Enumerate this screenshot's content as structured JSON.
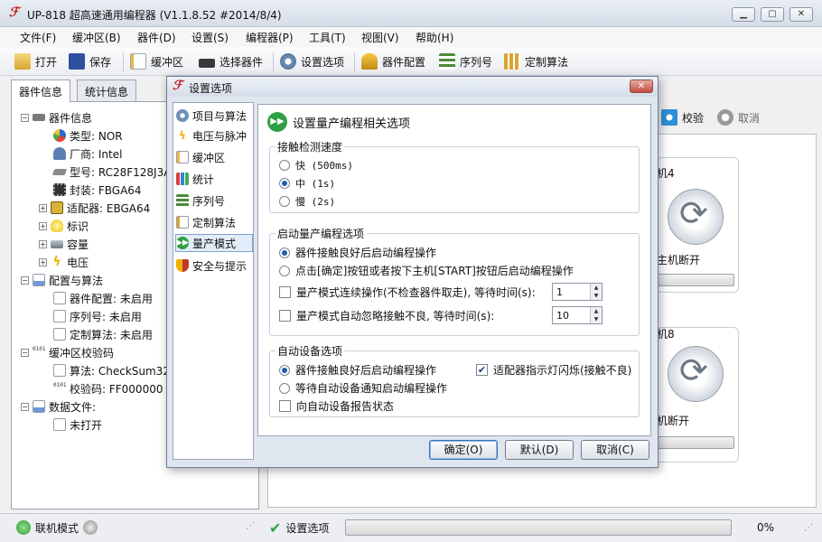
{
  "window": {
    "title": "UP-818 超高速通用编程器  (V1.1.8.52 #2014/8/4)"
  },
  "menu": [
    "文件(F)",
    "缓冲区(B)",
    "器件(D)",
    "设置(S)",
    "编程器(P)",
    "工具(T)",
    "视图(V)",
    "帮助(H)"
  ],
  "toolbar": {
    "open": "打开",
    "save": "保存",
    "buffer": "缓冲区",
    "select_device": "选择器件",
    "settings": "设置选项",
    "device_config": "器件配置",
    "serial": "序列号",
    "custom_algo": "定制算法"
  },
  "left_tabs": {
    "device_info": "器件信息",
    "stats": "统计信息"
  },
  "tree": {
    "device_info": "器件信息",
    "type": "类型: NOR",
    "vendor": "厂商: Intel",
    "model": "型号: RC28F128J3A",
    "package": "封装: FBGA64",
    "adapter": "适配器: EBGA64",
    "mark": "标识",
    "capacity": "容量",
    "voltage": "电压",
    "config_algo": "配置与算法",
    "dev_config": "器件配置: 未启用",
    "serial": "序列号: 未启用",
    "custom": "定制算法: 未启用",
    "checksum": "缓冲区校验码",
    "algorithm": "算法: CheckSum32",
    "check_code": "校验码: FF000000",
    "data_file": "数据文件:",
    "not_open": "未打开"
  },
  "right": {
    "verify": "校验",
    "cancel": "取消",
    "site4": "机4",
    "site8": "机8",
    "disconnected1": "主机断开",
    "disconnected2": "机断开"
  },
  "status": {
    "mode": "联机模式",
    "task": "设置选项",
    "progress_pct": "0%",
    "progress": 0
  },
  "dialog": {
    "title": "设置选项",
    "nav": [
      "项目与算法",
      "电压与脉冲",
      "缓冲区",
      "统计",
      "序列号",
      "定制算法",
      "量产模式",
      "安全与提示"
    ],
    "heading": "设置量产编程相关选项",
    "contact_speed": {
      "title": "接触检测速度",
      "fast": "快 (500ms)",
      "medium": "中 (1s)",
      "slow": "慢 (2s)",
      "selected": "medium"
    },
    "start_options": {
      "title": "启动量产编程选项",
      "opt1": "器件接触良好后启动编程操作",
      "opt2": "点击[确定]按钮或者按下主机[START]按钮后启动编程操作",
      "chk1": "量产模式连续操作(不检查器件取走), 等待时间(s):",
      "chk1_value": "1",
      "chk2": "量产模式自动忽略接触不良, 等待时间(s):",
      "chk2_value": "10"
    },
    "auto_device": {
      "title": "自动设备选项",
      "opt1": "器件接触良好后启动编程操作",
      "opt2": "等待自动设备通知启动编程操作",
      "chk_report": "向自动设备报告状态",
      "chk_adapter": "适配器指示灯闪烁(接触不良)"
    },
    "buttons": {
      "ok": "确定(O)",
      "default": "默认(D)",
      "cancel": "取消(C)"
    }
  },
  "colors": {
    "accent": "#1f5fb0",
    "ok_green": "#2ea043"
  }
}
